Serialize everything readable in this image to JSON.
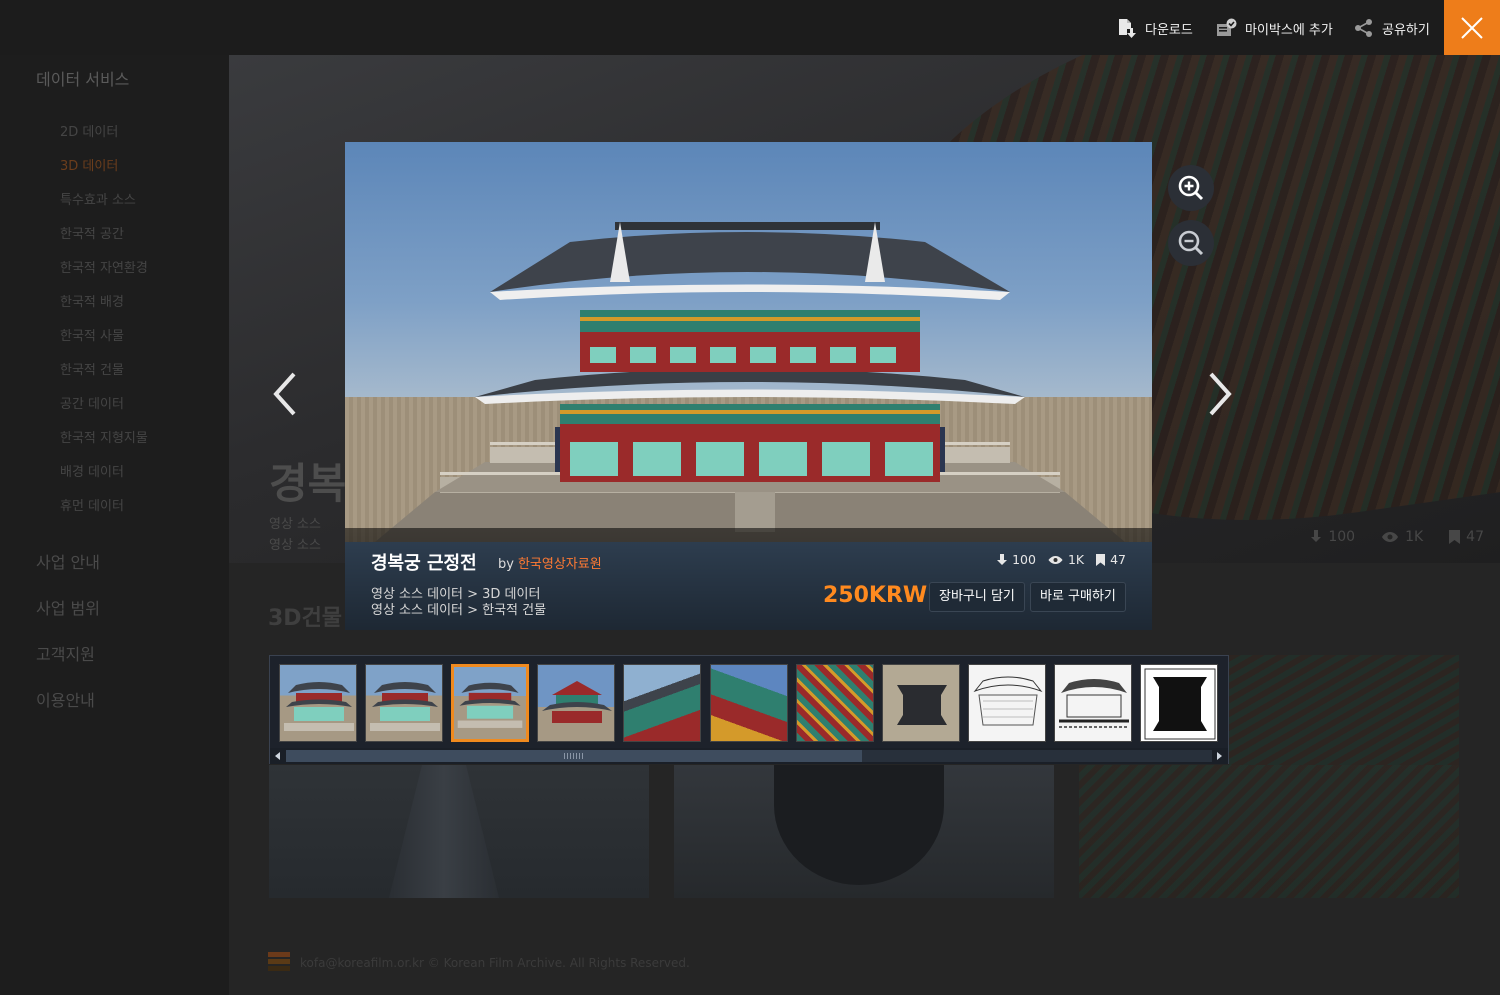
{
  "background": {
    "sidebar": {
      "title": "데이터 서비스",
      "items": [
        "2D 데이터",
        "3D 데이터",
        "특수효과 소스",
        "한국적 공간",
        "한국적 자연환경",
        "한국적 배경",
        "한국적 사물",
        "한국적 건물",
        "공간 데이터",
        "한국적 지형지물",
        "배경 데이터",
        "휴먼 데이터"
      ],
      "active_index": 1,
      "main_items": [
        "사업 안내",
        "사업 범위",
        "고객지원",
        "이용안내"
      ]
    },
    "hero": {
      "title": "경복",
      "sub1": "영상 소스",
      "sub2": "영상 소스",
      "downloads": "100",
      "views": "1K",
      "bookmarks": "47"
    },
    "section_title": "3D건물",
    "footer": "kofa@koreafilm.or.kr © Korean Film Archive. All Rights Reserved."
  },
  "topbar": {
    "download_label": "다운로드",
    "mybox_label": "마이박스에 추가",
    "share_label": "공유하기"
  },
  "viewer": {
    "title": "경복궁 근정전",
    "by": "by",
    "author": "한국영상자료원",
    "path1": "영상 소스 데이터 > 3D 데이터",
    "path2": "영상 소스 데이터 > 한국적 건물",
    "downloads": "100",
    "views": "1K",
    "bookmarks": "47",
    "price": "250KRW",
    "cart_label": "장바구니 담기",
    "buy_label": "바로 구매하기"
  },
  "thumbnails": {
    "count": 11,
    "selected_index": 2,
    "scroll_fraction_visible": 0.62
  },
  "colors": {
    "accent": "#ee7d1a",
    "price": "#ff8a1f",
    "author": "#ff7a33",
    "selected_border": "#f08a1e"
  }
}
